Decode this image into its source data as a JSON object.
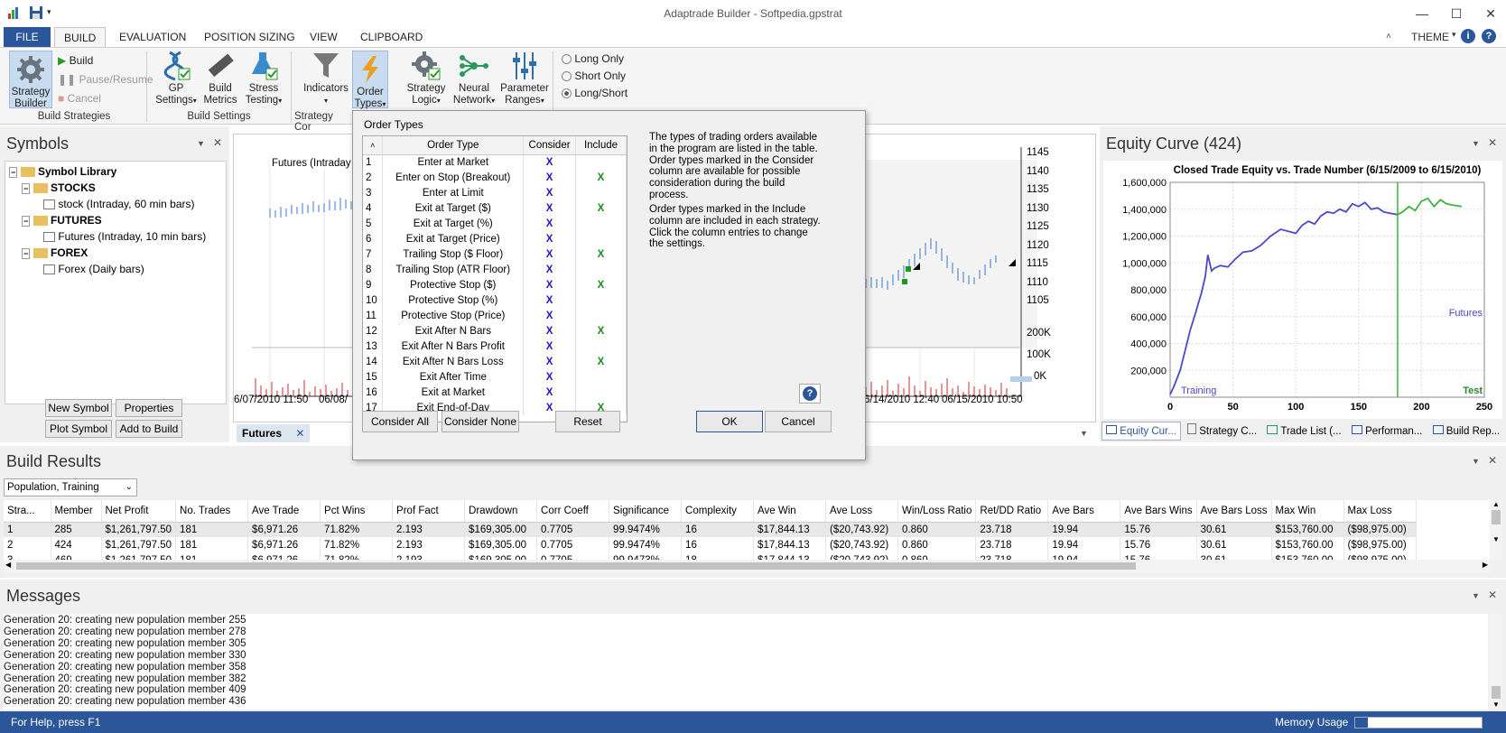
{
  "window": {
    "title": "Adaptrade Builder - Softpedia.gpstrat"
  },
  "ribbon_tabs": [
    {
      "label": "FILE"
    },
    {
      "label": "BUILD"
    },
    {
      "label": "EVALUATION"
    },
    {
      "label": "POSITION SIZING"
    },
    {
      "label": "VIEW"
    },
    {
      "label": "CLIPBOARD"
    }
  ],
  "theme_label": "THEME",
  "ribbon": {
    "strategy_builder": "Strategy Builder",
    "build": "Build",
    "pause_resume": "Pause/Resume",
    "cancel": "Cancel",
    "group_build_strategies": "Build Strategies",
    "gp_settings": "GP Settings",
    "build_metrics": "Build Metrics",
    "stress_testing": "Stress Testing",
    "group_build_settings": "Build Settings",
    "indicators": "Indicators",
    "order_types": "Order Types",
    "group_strategy_comp": "Strategy Cor",
    "strategy_logic": "Strategy Logic",
    "neural_network": "Neural Network",
    "parameter_ranges": "Parameter Ranges",
    "long_only": "Long Only",
    "short_only": "Short Only",
    "long_short": "Long/Short"
  },
  "symbols": {
    "title": "Symbols",
    "library": "Symbol Library",
    "stocks": "STOCKS",
    "stock_item": "stock (Intraday, 60 min bars)",
    "futures": "FUTURES",
    "futures_item": "Futures (Intraday, 10 min bars)",
    "forex": "FOREX",
    "forex_item": "Forex (Daily bars)",
    "new_symbol": "New Symbol",
    "properties": "Properties",
    "plot_symbol": "Plot Symbol",
    "add_to_build": "Add to Build"
  },
  "price_chart": {
    "legend": "Futures (Intraday",
    "tab": "Futures",
    "price_ticks": [
      "1145",
      "1140",
      "1135",
      "1130",
      "1125",
      "1120",
      "1115",
      "1110",
      "1105"
    ],
    "volume_ticks": [
      "200K",
      "100K",
      "0K"
    ],
    "date_left": [
      "6/07/2010 11:50",
      "06/08/"
    ],
    "date_right": [
      "6/14/2010 12:40",
      "06/15/2010 10:50"
    ]
  },
  "dialog": {
    "title": "Order Types",
    "col_type": "Order Type",
    "col_consider": "Consider",
    "col_include": "Include",
    "rows": [
      {
        "n": "1",
        "type": "Enter at Market",
        "c": "X",
        "i": ""
      },
      {
        "n": "2",
        "type": "Enter on Stop (Breakout)",
        "c": "X",
        "i": "X"
      },
      {
        "n": "3",
        "type": "Enter at Limit",
        "c": "X",
        "i": ""
      },
      {
        "n": "4",
        "type": "Exit at Target ($)",
        "c": "X",
        "i": "X"
      },
      {
        "n": "5",
        "type": "Exit at Target (%)",
        "c": "X",
        "i": ""
      },
      {
        "n": "6",
        "type": "Exit at Target (Price)",
        "c": "X",
        "i": ""
      },
      {
        "n": "7",
        "type": "Trailing Stop ($ Floor)",
        "c": "X",
        "i": "X"
      },
      {
        "n": "8",
        "type": "Trailing Stop (ATR Floor)",
        "c": "X",
        "i": ""
      },
      {
        "n": "9",
        "type": "Protective Stop ($)",
        "c": "X",
        "i": "X"
      },
      {
        "n": "10",
        "type": "Protective Stop (%)",
        "c": "X",
        "i": ""
      },
      {
        "n": "11",
        "type": "Protective Stop (Price)",
        "c": "X",
        "i": ""
      },
      {
        "n": "12",
        "type": "Exit After N Bars",
        "c": "X",
        "i": "X"
      },
      {
        "n": "13",
        "type": "Exit After N Bars Profit",
        "c": "X",
        "i": ""
      },
      {
        "n": "14",
        "type": "Exit After N Bars Loss",
        "c": "X",
        "i": "X"
      },
      {
        "n": "15",
        "type": "Exit After Time",
        "c": "X",
        "i": ""
      },
      {
        "n": "16",
        "type": "Exit at Market",
        "c": "X",
        "i": ""
      },
      {
        "n": "17",
        "type": "Exit End-of-Day",
        "c": "X",
        "i": "X"
      }
    ],
    "help1": "The types of trading orders available in the program are listed in the table. Order types marked in the Consider column are available for possible consideration during the build process.",
    "help2": "Order types marked in the Include column are included in each strategy. Click the column entries to change the settings.",
    "consider_all": "Consider All",
    "consider_none": "Consider None",
    "reset": "Reset",
    "ok": "OK",
    "cancel": "Cancel",
    "colors": {
      "consider": "#1a1acc",
      "include": "#1a8a1a"
    }
  },
  "equity": {
    "title": "Equity Curve (424)",
    "chart_data": {
      "type": "line",
      "title": "Closed Trade Equity vs. Trade Number (6/15/2009 to 6/15/2010)",
      "xlim": [
        0,
        250
      ],
      "ylim": [
        0,
        1600000
      ],
      "x_ticks": [
        "0",
        "50",
        "100",
        "150",
        "200",
        "250"
      ],
      "y_ticks": [
        "1,600,000",
        "1,400,000",
        "1,200,000",
        "1,000,000",
        "800,000",
        "600,000",
        "400,000",
        "200,000"
      ],
      "split_x": 181,
      "series": [
        {
          "name": "Training",
          "color": "#4a4ac8",
          "x": [
            0,
            3,
            8,
            12,
            16,
            20,
            25,
            28,
            30,
            33,
            35,
            40,
            46,
            52,
            58,
            65,
            72,
            80,
            88,
            96,
            100,
            105,
            110,
            115,
            120,
            125,
            130,
            135,
            140,
            145,
            150,
            155,
            160,
            165,
            170,
            175,
            181
          ],
          "y": [
            20000,
            80000,
            200000,
            350000,
            500000,
            620000,
            780000,
            900000,
            1060000,
            940000,
            960000,
            980000,
            970000,
            1030000,
            1080000,
            1090000,
            1130000,
            1200000,
            1250000,
            1230000,
            1220000,
            1280000,
            1310000,
            1290000,
            1350000,
            1380000,
            1370000,
            1400000,
            1380000,
            1440000,
            1420000,
            1450000,
            1400000,
            1410000,
            1380000,
            1370000,
            1360000
          ]
        },
        {
          "name": "Futures",
          "color": "#3cb43c",
          "x": [
            181,
            185,
            190,
            195,
            200,
            205,
            210,
            215,
            220,
            225,
            232
          ],
          "y": [
            1360000,
            1380000,
            1420000,
            1390000,
            1460000,
            1480000,
            1420000,
            1470000,
            1440000,
            1430000,
            1420000
          ]
        }
      ],
      "labels": {
        "training": "Training",
        "futures": "Futures",
        "test": "Test"
      }
    },
    "tabs": [
      "Equity Cur...",
      "Strategy C...",
      "Trade List (...",
      "Performan...",
      "Build Rep..."
    ]
  },
  "build_results": {
    "title": "Build Results",
    "dropdown": "Population, Training",
    "columns": [
      "Stra...",
      "Member",
      "Net Profit",
      "No. Trades",
      "Ave Trade",
      "Pct Wins",
      "Prof Fact",
      "Drawdown",
      "Corr Coeff",
      "Significance",
      "Complexity",
      "Ave Win",
      "Ave Loss",
      "Win/Loss Ratio",
      "Ret/DD Ratio",
      "Ave Bars",
      "Ave Bars Wins",
      "Ave Bars Loss",
      "Max Win",
      "Max Loss"
    ],
    "rows": [
      [
        "1",
        "285",
        "$1,261,797.50",
        "181",
        "$6,971.26",
        "71.82%",
        "2.193",
        "$169,305.00",
        "0.7705",
        "99.9474%",
        "16",
        "$17,844.13",
        "($20,743.92)",
        "0.860",
        "23.718",
        "19.94",
        "15.76",
        "30.61",
        "$153,760.00",
        "($98,975.00)"
      ],
      [
        "2",
        "424",
        "$1,261,797.50",
        "181",
        "$6,971.26",
        "71.82%",
        "2.193",
        "$169,305.00",
        "0.7705",
        "99.9474%",
        "16",
        "$17,844.13",
        "($20,743.92)",
        "0.860",
        "23.718",
        "19.94",
        "15.76",
        "30.61",
        "$153,760.00",
        "($98,975.00)"
      ],
      [
        "3",
        "469",
        "$1,261,797.50",
        "181",
        "$6,971.26",
        "71.82%",
        "2.193",
        "$169,305.00",
        "0.7705",
        "99.9473%",
        "18",
        "$17,844.13",
        "($20,743.92)",
        "0.860",
        "23.718",
        "19.94",
        "15.76",
        "30.61",
        "$153,760.00",
        "($98,975.00)"
      ]
    ]
  },
  "messages": {
    "title": "Messages",
    "lines": [
      "Generation 20: creating new population member 255",
      "Generation 20: creating new population member 278",
      "Generation 20: creating new population member 305",
      "Generation 20: creating new population member 330",
      "Generation 20: creating new population member 358",
      "Generation 20: creating new population member 382",
      "Generation 20: creating new population member 409",
      "Generation 20: creating new population member 436"
    ]
  },
  "status": {
    "help": "For Help, press F1",
    "memory": "Memory Usage",
    "memory_fraction": 0.1
  },
  "colors": {
    "accent": "#2b579a"
  }
}
